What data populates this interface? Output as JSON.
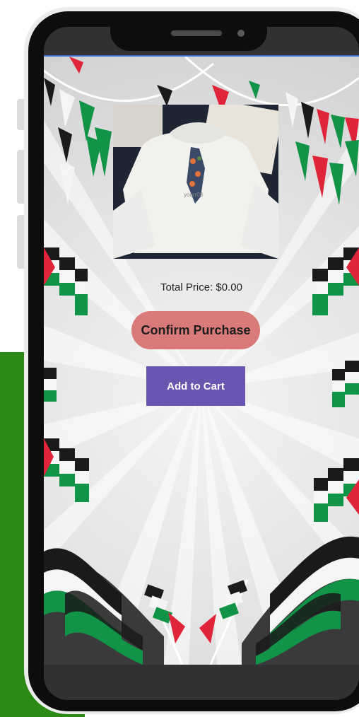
{
  "product": {
    "image_alt": "White hoodie with Palestine map print",
    "shirt_print_text": "yourr03"
  },
  "checkout": {
    "total_price": "Total Price: $0.00",
    "confirm_label": "Confirm Purchase",
    "add_to_cart_label": "Add to Cart"
  },
  "colors": {
    "page_green": "#2a8a14",
    "confirm_button": "#d87a7a",
    "add_to_cart_button": "#6a55b0",
    "flag_black": "#1a1a1a",
    "flag_white": "#f5f5f5",
    "flag_green": "#119447",
    "flag_red": "#e0243a"
  },
  "icons": {
    "speaker": "speaker-grille-icon",
    "camera": "front-camera-icon"
  }
}
